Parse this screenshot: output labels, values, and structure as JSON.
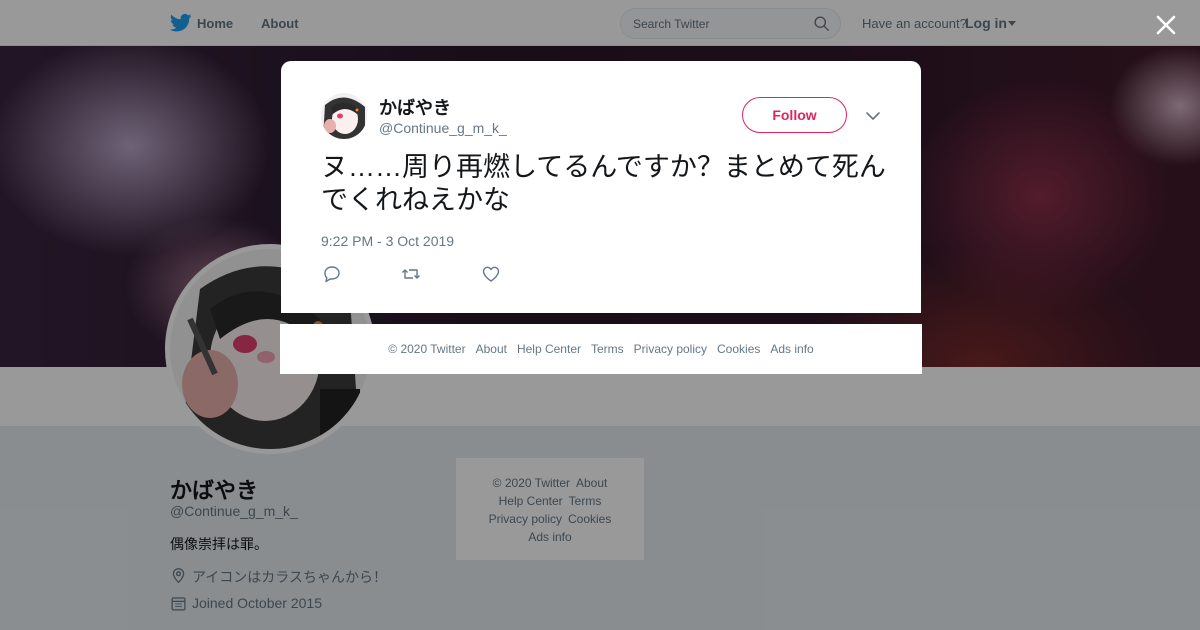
{
  "nav": {
    "home": "Home",
    "about": "About",
    "search_placeholder": "Search Twitter",
    "have_account": "Have an account?",
    "login": "Log in"
  },
  "profile": {
    "name": "かばやき",
    "handle": "@Continue_g_m_k_",
    "bio": "偶像崇拝は罪。",
    "location": "アイコンはカラスちゃんから！",
    "joined": "Joined October 2015"
  },
  "side_footer": {
    "copyright": "© 2020 Twitter",
    "about": "About",
    "help": "Help Center",
    "terms": "Terms",
    "privacy": "Privacy policy",
    "cookies": "Cookies",
    "ads": "Ads info"
  },
  "tweet": {
    "name": "かばやき",
    "handle": "@Continue_g_m_k_",
    "follow_label": "Follow",
    "text": "ヌ……周り再燃してるんですか？まとめて死んでくれねえかな",
    "time": "9:22 PM - 3 Oct 2019"
  },
  "modal_footer": {
    "copyright": "© 2020 Twitter",
    "about": "About",
    "help": "Help Center",
    "terms": "Terms",
    "privacy": "Privacy policy",
    "cookies": "Cookies",
    "ads": "Ads info"
  },
  "icons": {
    "logo": "twitter-bird-icon",
    "search": "search-icon",
    "close": "close-icon",
    "reply": "reply-icon",
    "retweet": "retweet-icon",
    "like": "heart-icon",
    "caret": "chevron-down-icon",
    "location": "location-pin-icon",
    "calendar": "calendar-icon"
  },
  "colors": {
    "twitter_blue": "#1da1f2",
    "follow_accent": "#e0245e",
    "secondary_text": "#657786"
  }
}
